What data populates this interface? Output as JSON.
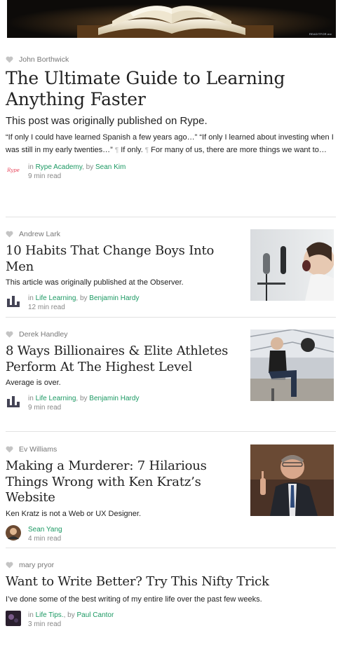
{
  "hero": {
    "credit": "READITFOR.me"
  },
  "stories": [
    {
      "recommender": "John Borthwick",
      "title": "The Ultimate Guide to Learning Anything Faster",
      "subtitle": "This post was originally published on Rype.",
      "excerpt_1": "“If only I could have learned Spanish a few years ago…” “If only I learned about investing when I was still in my early twenties…”",
      "excerpt_2": "If only.",
      "excerpt_3": "For many of us, there are more things we want to…",
      "pilcrow": "¶",
      "publication": "Rype Academy",
      "by": ", by ",
      "author": "Sean Kim",
      "read_time": "9 min read",
      "logo_text": "Rype"
    },
    {
      "recommender": "Andrew Lark",
      "title": "10 Habits That Change Boys Into Men",
      "description": "This article was originally published at the Observer.",
      "prefix": "in ",
      "publication": "Life Learning",
      "by": ", by ",
      "author": "Benjamin Hardy",
      "read_time": "12 min read"
    },
    {
      "recommender": "Derek Handley",
      "title": "8 Ways Billionaires & Elite Athletes Perform At The Highest Level",
      "description": "Average is over.",
      "prefix": "in ",
      "publication": "Life Learning",
      "by": ", by ",
      "author": "Benjamin Hardy",
      "read_time": "9 min read"
    },
    {
      "recommender": "Ev Williams",
      "title": "Making a Murderer: 7 Hilarious Things Wrong with Ken Kratz’s Website",
      "description": "Ken Kratz is not a Web or UX Designer.",
      "author": "Sean Yang",
      "read_time": "4 min read"
    },
    {
      "recommender": "mary pryor",
      "title": "Want to Write Better? Try This Nifty Trick",
      "description": "I’ve done some of the best writing of my entire life over the past few weeks.",
      "prefix": "in ",
      "publication": "Life Tips.",
      "by": ", by ",
      "author": "Paul Cantor",
      "read_time": "3 min read"
    }
  ],
  "colors": {
    "link": "#1c9963",
    "heart": "#c4c4c4",
    "divider": "#e2e2e2"
  }
}
